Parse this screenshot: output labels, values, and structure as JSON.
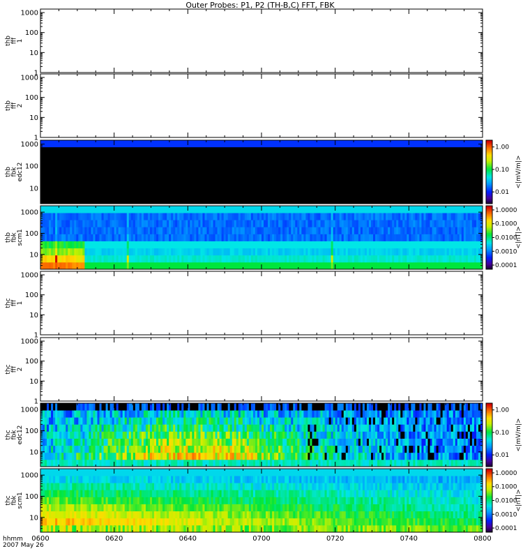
{
  "chart_data": {
    "type": "heatmap",
    "title": "Outer Probes: P1, P2 (TH-B,C) FFT, FBK",
    "x_ticks": [
      "0600",
      "0620",
      "0640",
      "0700",
      "0720",
      "0740",
      "0800"
    ],
    "x_time_label": "hhmm",
    "x_date_label": "2007 May 26",
    "y_scale": "log",
    "panels": [
      {
        "name": "thb-fff-1",
        "label_lines": [
          "thb",
          "fff",
          "1"
        ],
        "ylim": [
          1,
          1500
        ],
        "y_ticks": [
          "1000",
          "100",
          "10",
          "1"
        ],
        "has_data": false
      },
      {
        "name": "thb-fff-2",
        "label_lines": [
          "thb",
          "fff",
          "2"
        ],
        "ylim": [
          1,
          1500
        ],
        "y_ticks": [
          "1000",
          "100",
          "10",
          "1"
        ],
        "has_data": false
      },
      {
        "name": "thb-fbk-edc12",
        "label_lines": [
          "thb",
          "fbk",
          "edc12"
        ],
        "ylim": [
          2,
          1500
        ],
        "y_ticks": [
          "1000",
          "100",
          "10"
        ],
        "has_data": true,
        "pattern": "thb_edc",
        "colorbar": {
          "ticks": [
            "1.00",
            "0.10",
            "0.01"
          ],
          "unit": "<|mV/m|>",
          "range": [
            0.003,
            2.0
          ]
        }
      },
      {
        "name": "thb-fbk-scm1",
        "label_lines": [
          "thb",
          "fbk",
          "scm1"
        ],
        "ylim": [
          2,
          2000
        ],
        "y_ticks": [
          "1000",
          "100",
          "10"
        ],
        "has_data": true,
        "pattern": "thb_scm",
        "colorbar": {
          "ticks": [
            "1.0000",
            "0.1000",
            "0.0100",
            "0.0010",
            "0.0001"
          ],
          "unit": "<|nT|>",
          "range": [
            5e-05,
            2.0
          ]
        }
      },
      {
        "name": "thc-fff-1",
        "label_lines": [
          "thc",
          "fff",
          "1"
        ],
        "ylim": [
          1,
          1500
        ],
        "y_ticks": [
          "1000",
          "100",
          "10",
          "1"
        ],
        "has_data": false
      },
      {
        "name": "thc-fff-2",
        "label_lines": [
          "thc",
          "fff",
          "2"
        ],
        "ylim": [
          1,
          1500
        ],
        "y_ticks": [
          "1000",
          "100",
          "10",
          "1"
        ],
        "has_data": false
      },
      {
        "name": "thc-fbk-edc12",
        "label_lines": [
          "thc",
          "fbk",
          "edc12"
        ],
        "ylim": [
          2,
          2000
        ],
        "y_ticks": [
          "1000",
          "100",
          "10"
        ],
        "has_data": true,
        "pattern": "thc_edc",
        "colorbar": {
          "ticks": [
            "1.00",
            "0.10",
            "0.01"
          ],
          "unit": "<|mV/m|>",
          "range": [
            0.003,
            2.0
          ]
        }
      },
      {
        "name": "thc-fbk-scm1",
        "label_lines": [
          "thc",
          "fbk",
          "scm1"
        ],
        "ylim": [
          2,
          2000
        ],
        "y_ticks": [
          "1000",
          "100",
          "10"
        ],
        "has_data": true,
        "pattern": "thc_scm",
        "colorbar": {
          "ticks": [
            "1.0000",
            "0.1000",
            "0.0100",
            "0.0010",
            "0.0001"
          ],
          "unit": "<|nT|>",
          "range": [
            5e-05,
            2.0
          ]
        }
      }
    ]
  }
}
